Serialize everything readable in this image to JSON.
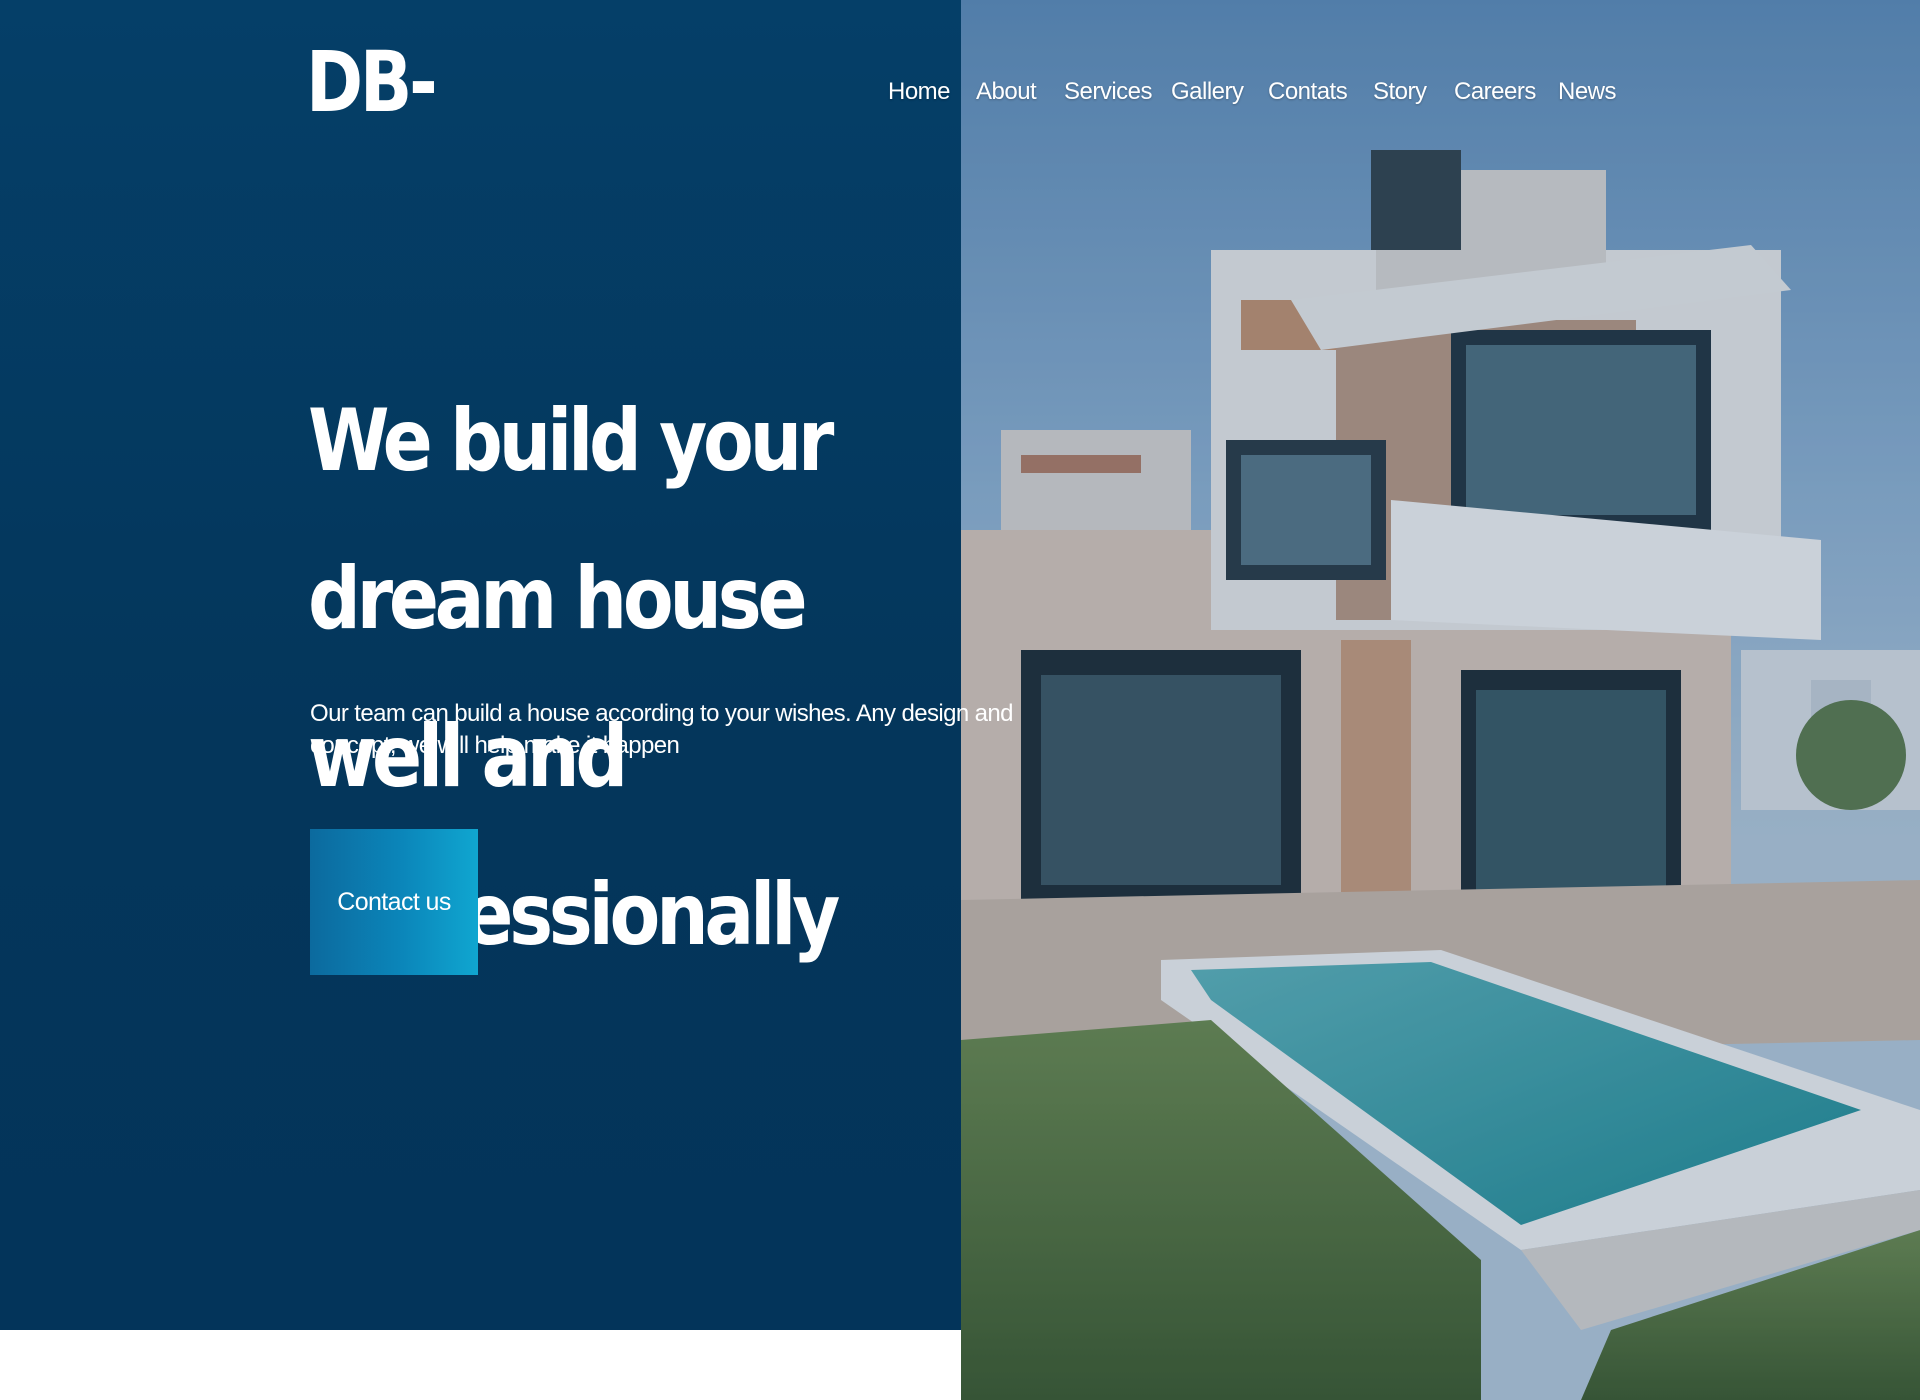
{
  "brand": {
    "logo_text": "DB-"
  },
  "nav": {
    "items": [
      {
        "label": "Home"
      },
      {
        "label": "About"
      },
      {
        "label": "Services"
      },
      {
        "label": "Gallery"
      },
      {
        "label": "Contats"
      },
      {
        "label": "Story"
      },
      {
        "label": "Careers"
      },
      {
        "label": "News"
      }
    ]
  },
  "hero": {
    "title_line1": "We build your dream house",
    "title_line2": "well and professionally",
    "subtitle": "Our team can build a house according to your wishes. Any design and concept, we will help make it happen",
    "cta_label": "Contact us"
  },
  "colors": {
    "panel_bg": "#053f68",
    "cta_gradient_start": "#0c6a9e",
    "cta_gradient_end": "#10a6d0",
    "text": "#ffffff"
  },
  "media": {
    "hero_image": "modern-house-with-pool-photo"
  }
}
